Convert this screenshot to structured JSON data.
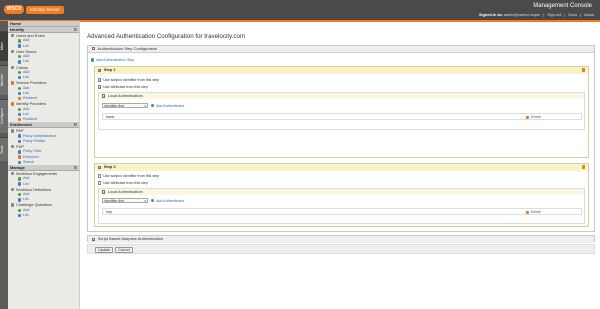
{
  "header": {
    "logo_mark": "WSO2",
    "logo_text": "Identity Server",
    "console_title": "Management Console",
    "signed_in_label": "Signed-in as:",
    "signed_in_user": "admin@carbon.super",
    "sign_out": "Sign-out",
    "docs": "Docs",
    "about": "About"
  },
  "vtabs": [
    "Main",
    "Monitor",
    "Configure",
    "Tools"
  ],
  "sidebar": {
    "home": "Home",
    "identity": "Identity",
    "users_and_roles": "Users and Roles",
    "user_stores": "User Stores",
    "claims": "Claims",
    "service_providers": "Service Providers",
    "identity_providers": "Identity Providers",
    "entitlement": "Entitlement",
    "pap": "PAP",
    "policy_administration": "Policy Administration",
    "policy_publish": "Policy Publish",
    "pdp": "PDP",
    "policy_view": "Policy View",
    "extension": "Extension",
    "search": "Search",
    "manage": "Manage",
    "workflow_engagements": "Workflow Engagements",
    "workflow_definitions": "Workflow Definitions",
    "challenge_questions": "Challenge Questions",
    "add": "Add",
    "list": "List",
    "resident": "Resident"
  },
  "main": {
    "title": "Advanced Authentication Configuration for travelocity.com",
    "step_config_title": "Authentication Step Configuration",
    "add_step": "Add Authentication Step",
    "use_subject": "Use subject identifier from this step",
    "use_attributes": "Use attributes from this step",
    "local_authenticators": "Local Authenticators",
    "add_authenticator": "Add Authenticator",
    "delete": "Delete",
    "steps": [
      {
        "title": "Step 1",
        "select_value": "identifier-first",
        "authenticator": "basic",
        "subject_checked": true,
        "attr_checked": true
      },
      {
        "title": "Step 2",
        "select_value": "identifier-first",
        "authenticator": "totp",
        "subject_checked": false,
        "attr_checked": false
      }
    ],
    "script_title": "Script Based Adaptive Authentication",
    "update_button": "Update",
    "cancel_button": "Cancel"
  },
  "colors": {
    "accent": "#f47b20",
    "link": "#2a6ebb",
    "step_header": "#fbf3c8"
  }
}
